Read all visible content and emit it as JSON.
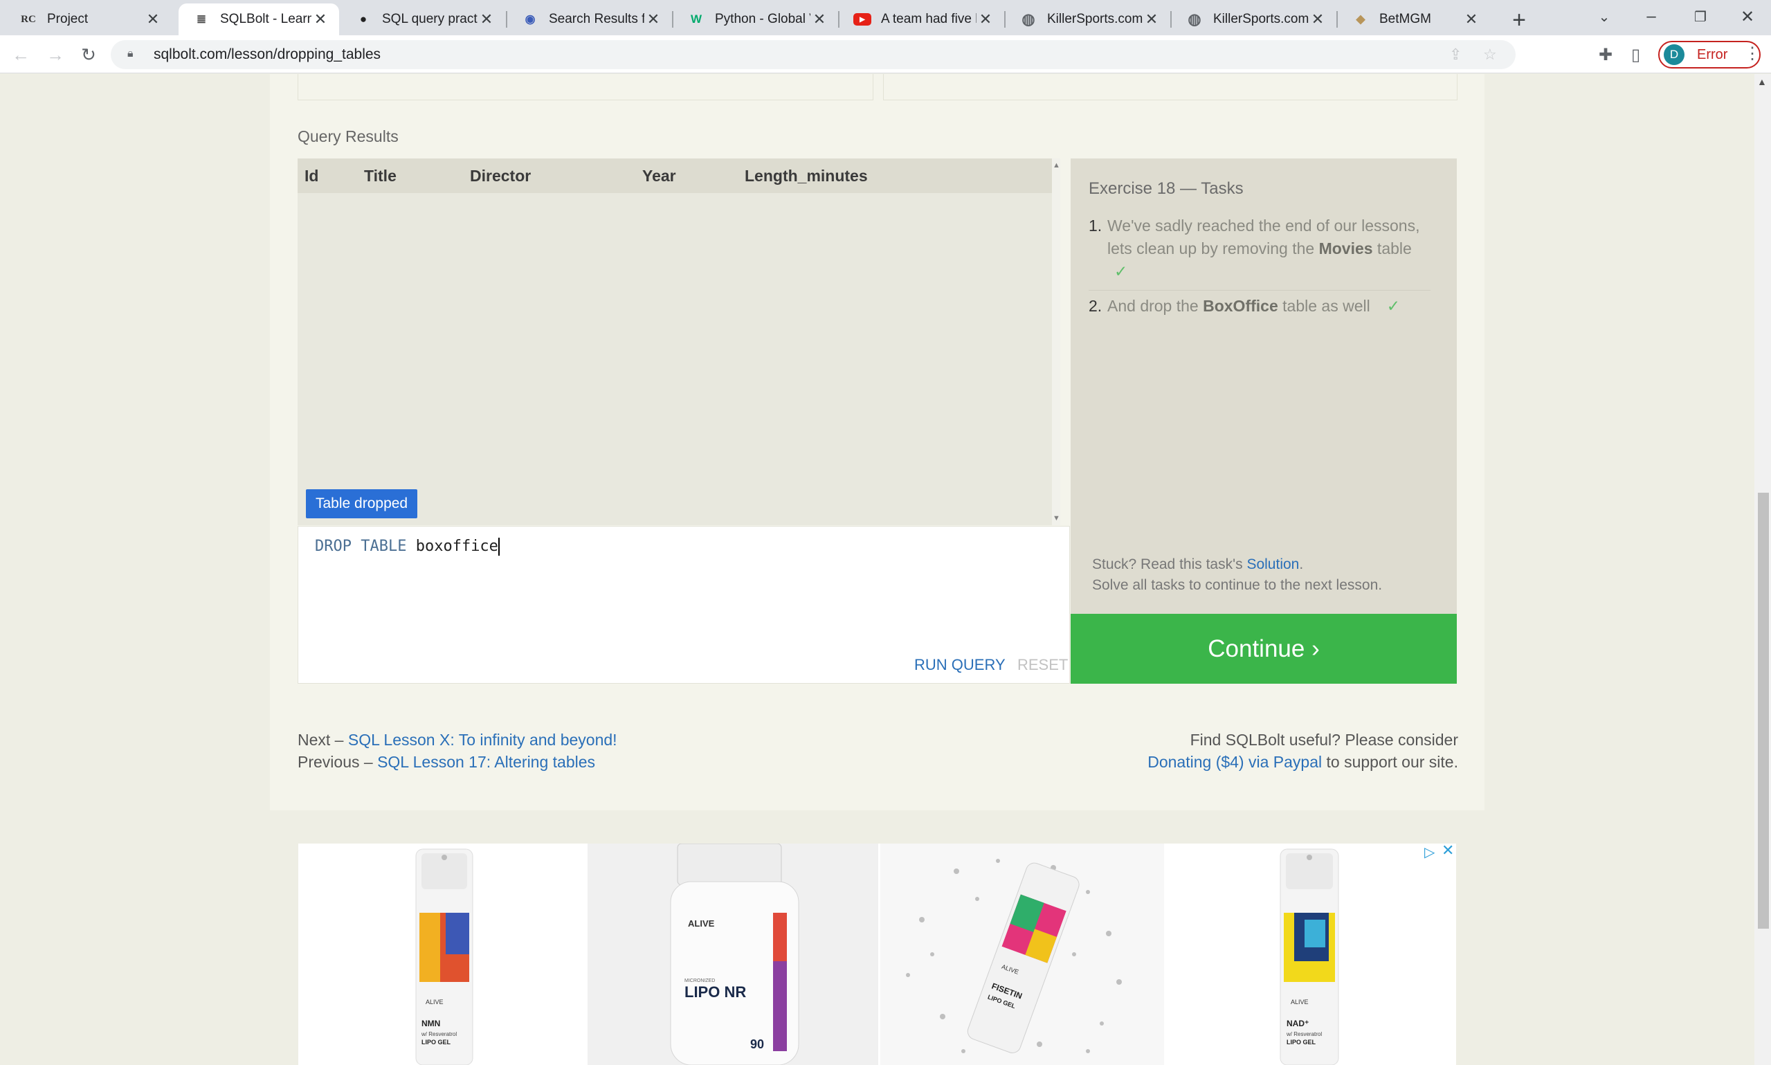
{
  "browser": {
    "tabs": [
      {
        "title": "Project",
        "icon": "rc-icon",
        "glyph": "RC"
      },
      {
        "title": "SQLBolt - Learn SQL",
        "icon": "database-icon",
        "glyph": "≣"
      },
      {
        "title": "SQL query practice",
        "icon": "github-icon",
        "glyph": "●"
      },
      {
        "title": "Search Results for",
        "icon": "search-site-icon",
        "glyph": "◉"
      },
      {
        "title": "Python - Global Var",
        "icon": "w3-icon",
        "glyph": "W"
      },
      {
        "title": "A team had five h",
        "icon": "youtube-icon",
        "glyph": "▶"
      },
      {
        "title": "KillerSports.com",
        "icon": "globe-icon",
        "glyph": "◍"
      },
      {
        "title": "KillerSports.com",
        "icon": "globe-icon",
        "glyph": "◍"
      },
      {
        "title": "BetMGM",
        "icon": "betmgm-icon",
        "glyph": "◆"
      }
    ],
    "url": "sqlbolt.com/lesson/dropping_tables",
    "profile_initial": "D",
    "profile_status": "Error"
  },
  "results": {
    "section_title": "Query Results",
    "columns": [
      "Id",
      "Title",
      "Director",
      "Year",
      "Length_minutes"
    ],
    "status_badge": "Table dropped"
  },
  "editor": {
    "keyword1": "DROP",
    "keyword2": "TABLE",
    "identifier": "boxoffice",
    "run_label": "RUN QUERY",
    "reset_label": "RESET"
  },
  "tasks": {
    "title": "Exercise 18 — Tasks",
    "items": [
      {
        "num": "1.",
        "pre": "We've sadly reached the end of our lessons, lets clean up by removing the ",
        "bold": "Movies",
        "post": " table",
        "check": "✓"
      },
      {
        "num": "2.",
        "pre": "And drop the ",
        "bold": "BoxOffice",
        "post": " table as well",
        "check": "✓"
      }
    ],
    "stuck_prefix": "Stuck? Read this task's ",
    "stuck_link": "Solution",
    "stuck_suffix": ".",
    "solve_note": "Solve all tasks to continue to the next lesson.",
    "continue_label": "Continue ›"
  },
  "footer_nav": {
    "next_prefix": "Next – ",
    "next_link": "SQL Lesson X: To infinity and beyond!",
    "prev_prefix": "Previous – ",
    "prev_link": "SQL Lesson 17: Altering tables",
    "useful_text": "Find SQLBolt useful? Please consider",
    "donate_link": "Donating ($4) via Paypal",
    "donate_suffix": " to support our site."
  },
  "ad": {
    "products": [
      {
        "brand": "ALIVE",
        "name": "NMN",
        "sub": "w/ Resveratrol",
        "type": "LIPO GEL"
      },
      {
        "brand": "ALIVE",
        "name": "LIPO NR",
        "sub": "MICRONIZED",
        "type": "90"
      },
      {
        "brand": "ALIVE",
        "name": "FISETIN",
        "sub": "",
        "type": "LIPO GEL"
      },
      {
        "brand": "ALIVE",
        "name": "NAD⁺",
        "sub": "w/ Resveratrol",
        "type": "LIPO GEL"
      }
    ],
    "adchoice_glyph": "▷",
    "close_glyph": "✕"
  },
  "colors": {
    "accent_blue": "#2a6fb8",
    "continue_green": "#3bb54a",
    "badge_blue": "#2a6fd6",
    "error_red": "#c5221f"
  }
}
